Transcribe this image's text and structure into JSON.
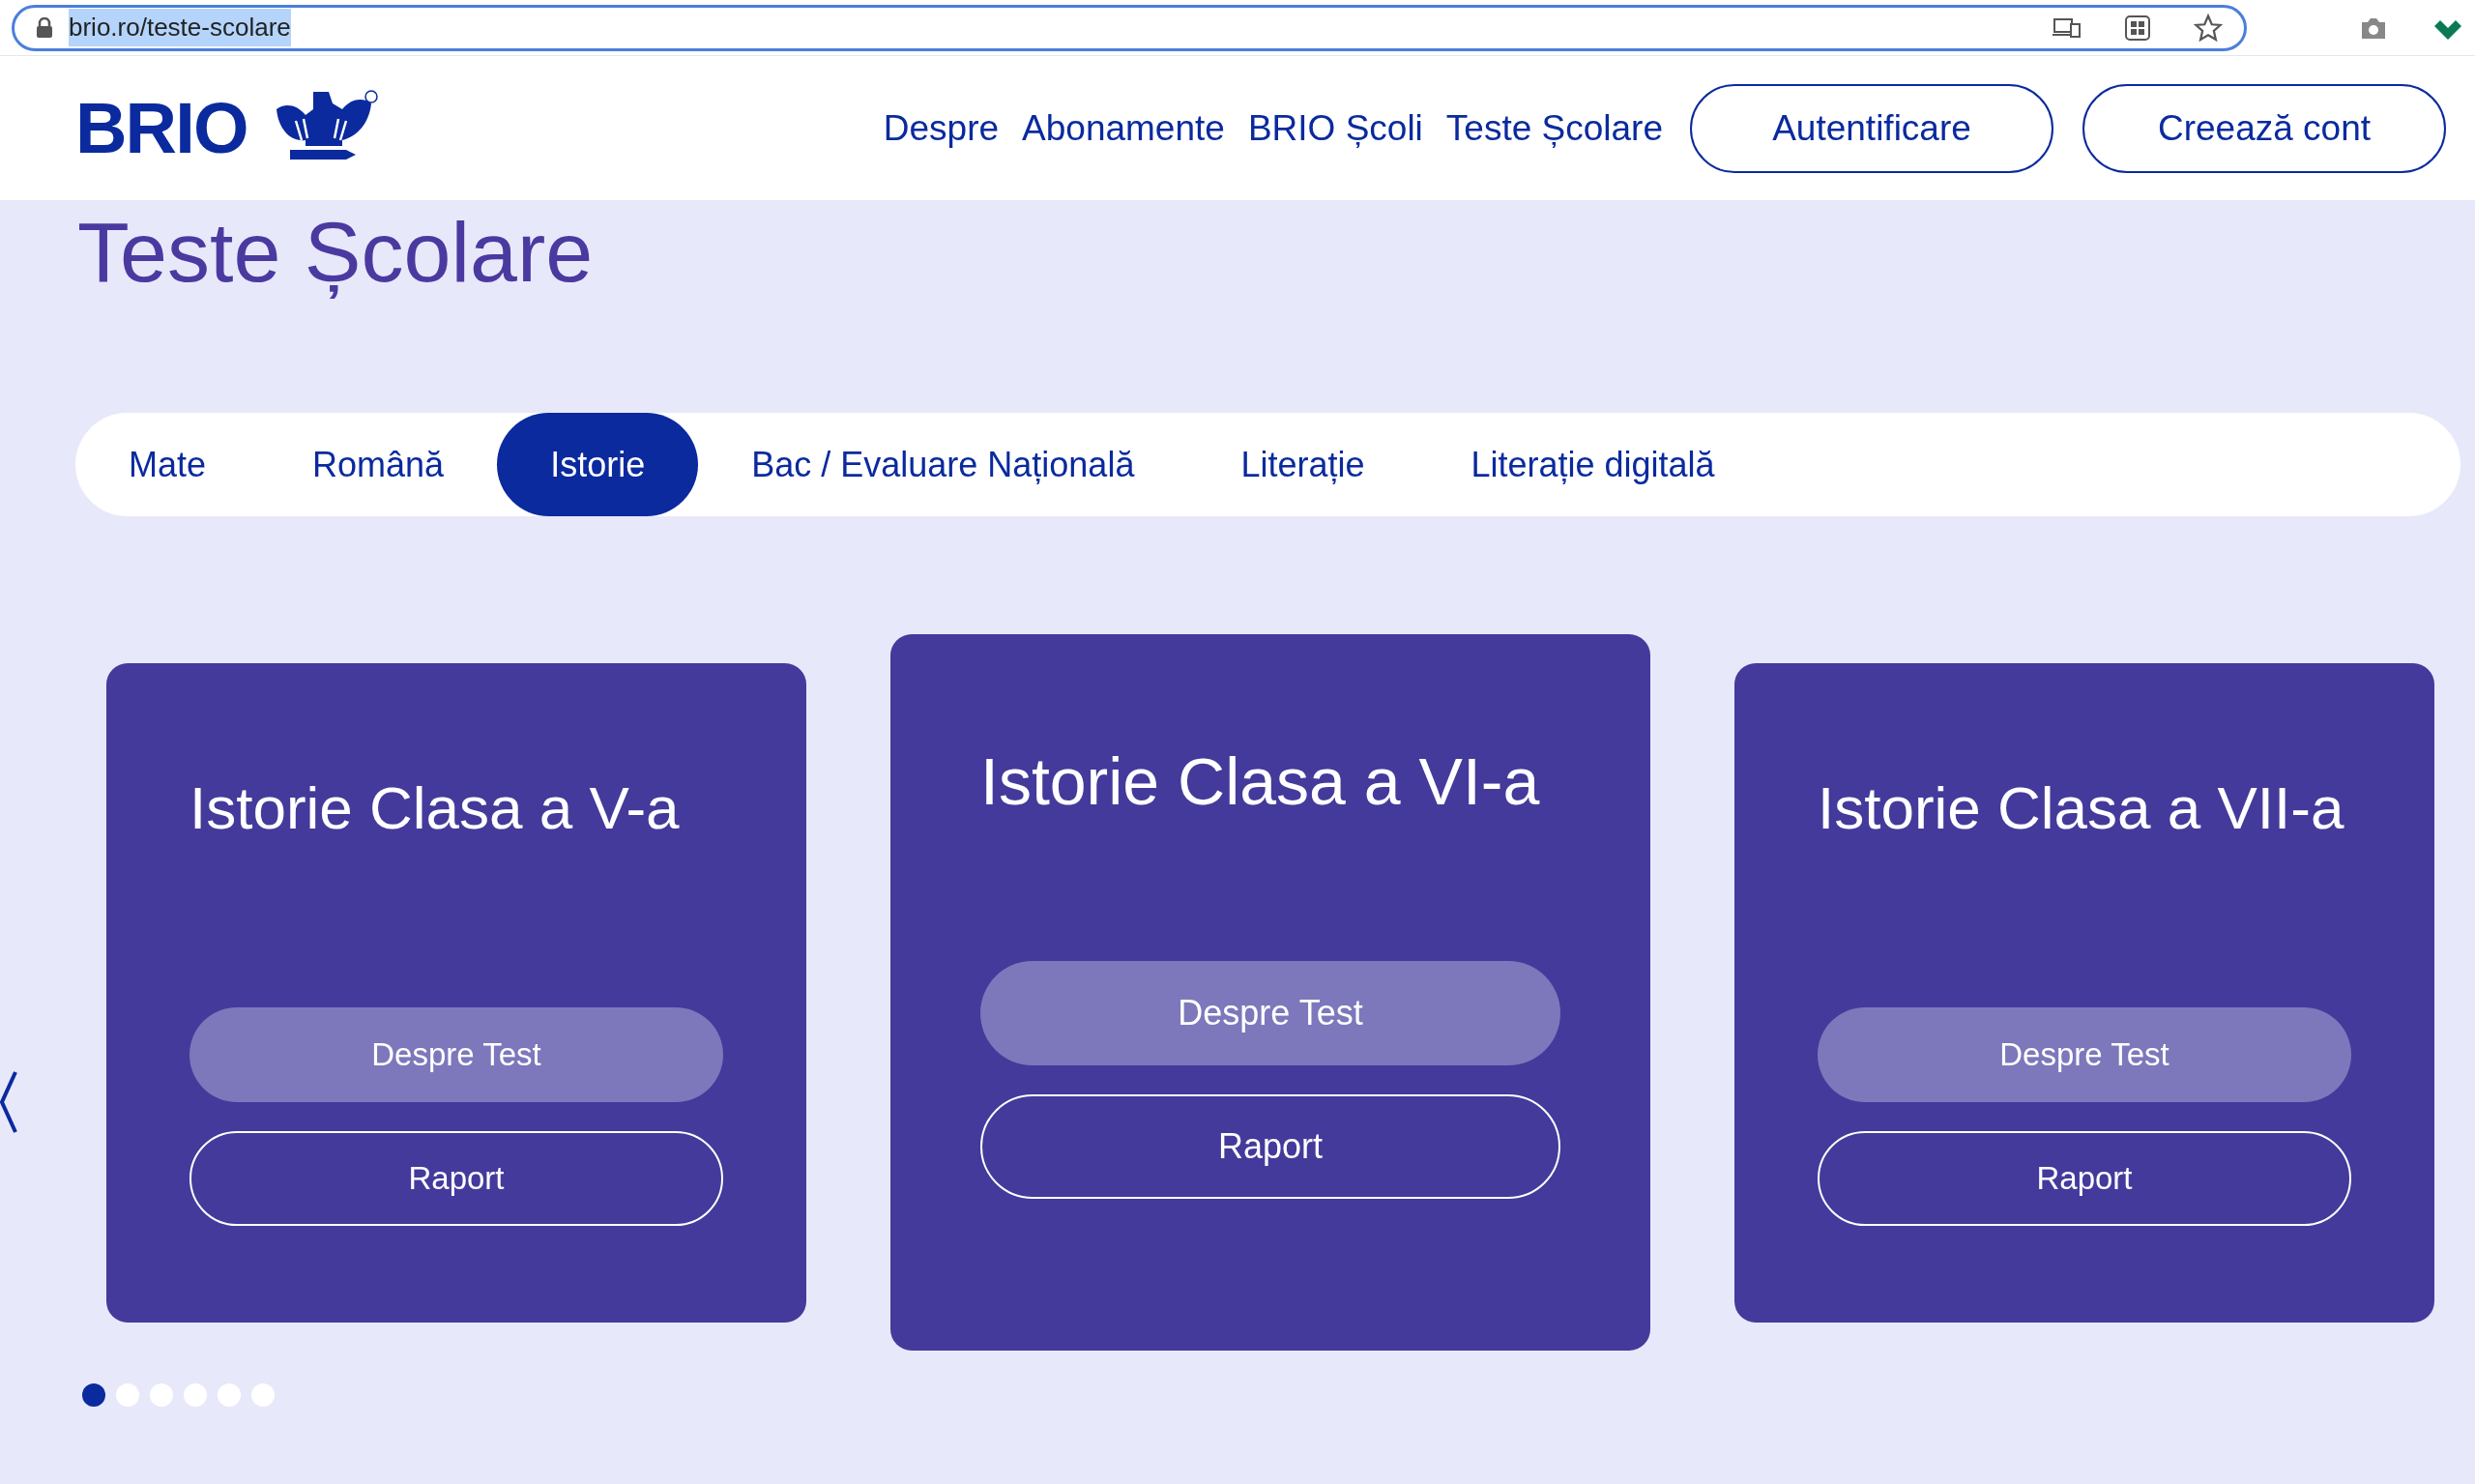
{
  "browser": {
    "url": "brio.ro/teste-scolare",
    "url_selected": true
  },
  "header": {
    "logo": "BRIO",
    "nav": [
      "Despre",
      "Abonamente",
      "BRIO Școli",
      "Teste Școlare"
    ],
    "buttons": [
      "Autentificare",
      "Creează cont"
    ]
  },
  "page_title": "Teste Școlare",
  "tabs": [
    {
      "label": "Mate",
      "selected": false
    },
    {
      "label": "Română",
      "selected": false
    },
    {
      "label": "Istorie",
      "selected": true
    },
    {
      "label": "Bac / Evaluare Națională",
      "selected": false
    },
    {
      "label": "Literație",
      "selected": false
    },
    {
      "label": "Literație digitală",
      "selected": false
    }
  ],
  "cards": [
    {
      "title": "Istorie Clasa a V-a",
      "focused": false,
      "buttons": [
        "Despre Test",
        "Raport"
      ]
    },
    {
      "title": "Istorie Clasa a VI-a",
      "focused": true,
      "buttons": [
        "Despre Test",
        "Raport"
      ]
    },
    {
      "title": "Istorie Clasa a VII-a",
      "focused": false,
      "buttons": [
        "Despre Test",
        "Raport"
      ]
    }
  ],
  "carousel_dots": [
    {
      "selected": true
    },
    {
      "selected": false
    },
    {
      "selected": false
    },
    {
      "selected": false
    },
    {
      "selected": false
    },
    {
      "selected": false
    }
  ]
}
